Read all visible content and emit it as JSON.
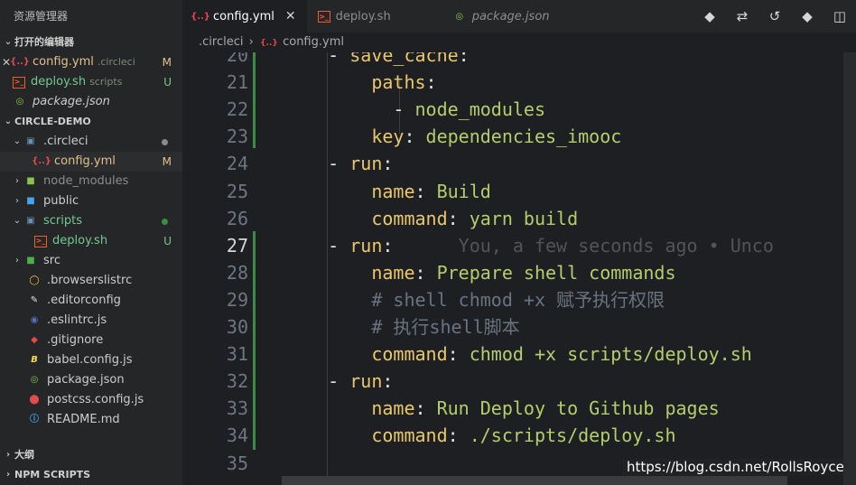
{
  "sidebar": {
    "title": "资源管理器",
    "open_editors": {
      "label": "打开的编辑器",
      "items": [
        {
          "name": "config.yml",
          "sub": ".circleci",
          "status": "M"
        },
        {
          "name": "deploy.sh",
          "sub": "scripts",
          "status": "U"
        },
        {
          "name": "package.json",
          "sub": "",
          "status": ""
        }
      ]
    },
    "project": {
      "label": "CIRCLE-DEMO",
      "items": [
        {
          "name": ".circleci",
          "status": ""
        },
        {
          "name": "config.yml",
          "status": "M"
        },
        {
          "name": "node_modules",
          "status": ""
        },
        {
          "name": "public",
          "status": ""
        },
        {
          "name": "scripts",
          "status": ""
        },
        {
          "name": "deploy.sh",
          "status": "U"
        },
        {
          "name": "src",
          "status": ""
        },
        {
          "name": ".browserslistrc",
          "status": ""
        },
        {
          "name": ".editorconfig",
          "status": ""
        },
        {
          "name": ".eslintrc.js",
          "status": ""
        },
        {
          "name": ".gitignore",
          "status": ""
        },
        {
          "name": "babel.config.js",
          "status": ""
        },
        {
          "name": "package.json",
          "status": ""
        },
        {
          "name": "postcss.config.js",
          "status": ""
        },
        {
          "name": "README.md",
          "status": ""
        }
      ]
    },
    "outline_label": "大纲",
    "npm_label": "NPM SCRIPTS"
  },
  "tabs": [
    {
      "label": "config.yml"
    },
    {
      "label": "deploy.sh"
    },
    {
      "label": "package.json"
    }
  ],
  "breadcrumb": {
    "folder": ".circleci",
    "file": "config.yml"
  },
  "editor": {
    "lines": [
      {
        "n": "20",
        "parts": [
          [
            "d",
            "    - "
          ],
          [
            "k",
            "save_cache"
          ],
          [
            "d",
            ":"
          ]
        ]
      },
      {
        "n": "21",
        "parts": [
          [
            "d",
            "        "
          ],
          [
            "k",
            "paths"
          ],
          [
            "d",
            ":"
          ]
        ]
      },
      {
        "n": "22",
        "parts": [
          [
            "d",
            "          - "
          ],
          [
            "v",
            "node_modules"
          ]
        ]
      },
      {
        "n": "23",
        "parts": [
          [
            "d",
            "        "
          ],
          [
            "k",
            "key"
          ],
          [
            "d",
            ": "
          ],
          [
            "v",
            "dependencies_imooc"
          ]
        ]
      },
      {
        "n": "24",
        "parts": [
          [
            "d",
            "    - "
          ],
          [
            "k",
            "run"
          ],
          [
            "d",
            ":"
          ]
        ]
      },
      {
        "n": "25",
        "parts": [
          [
            "d",
            "        "
          ],
          [
            "k",
            "name"
          ],
          [
            "d",
            ": "
          ],
          [
            "v",
            "Build"
          ]
        ]
      },
      {
        "n": "26",
        "parts": [
          [
            "d",
            "        "
          ],
          [
            "k",
            "command"
          ],
          [
            "d",
            ": "
          ],
          [
            "v",
            "yarn build"
          ]
        ]
      },
      {
        "n": "27",
        "parts": [
          [
            "d",
            "    - "
          ],
          [
            "k",
            "run"
          ],
          [
            "d",
            ":"
          ],
          [
            "ghost",
            "      You, a few seconds ago • Unco"
          ]
        ]
      },
      {
        "n": "28",
        "parts": [
          [
            "d",
            "        "
          ],
          [
            "k",
            "name"
          ],
          [
            "d",
            ": "
          ],
          [
            "v",
            "Prepare shell commands"
          ]
        ]
      },
      {
        "n": "29",
        "parts": [
          [
            "d",
            "        "
          ],
          [
            "c",
            "# shell chmod +x 赋予执行权限"
          ]
        ]
      },
      {
        "n": "30",
        "parts": [
          [
            "d",
            "        "
          ],
          [
            "c",
            "# 执行shell脚本"
          ]
        ]
      },
      {
        "n": "31",
        "parts": [
          [
            "d",
            "        "
          ],
          [
            "k",
            "command"
          ],
          [
            "d",
            ": "
          ],
          [
            "v",
            "chmod +x scripts/deploy.sh"
          ]
        ]
      },
      {
        "n": "32",
        "parts": [
          [
            "d",
            "    - "
          ],
          [
            "k",
            "run"
          ],
          [
            "d",
            ":"
          ]
        ]
      },
      {
        "n": "33",
        "parts": [
          [
            "d",
            "        "
          ],
          [
            "k",
            "name"
          ],
          [
            "d",
            ": "
          ],
          [
            "v",
            "Run Deploy to Github pages"
          ]
        ]
      },
      {
        "n": "34",
        "parts": [
          [
            "d",
            "        "
          ],
          [
            "k",
            "command"
          ],
          [
            "d",
            ": "
          ],
          [
            "v",
            "./scripts/deploy.sh"
          ]
        ]
      },
      {
        "n": "35",
        "parts": []
      }
    ]
  },
  "watermark": "https://blog.csdn.net/RollsRoyce",
  "colors": {
    "key": "#e8c86a",
    "value": "#b6cd6b",
    "comment": "#6a7380",
    "modified": "#3b8c45",
    "untracked": "#73c991"
  }
}
